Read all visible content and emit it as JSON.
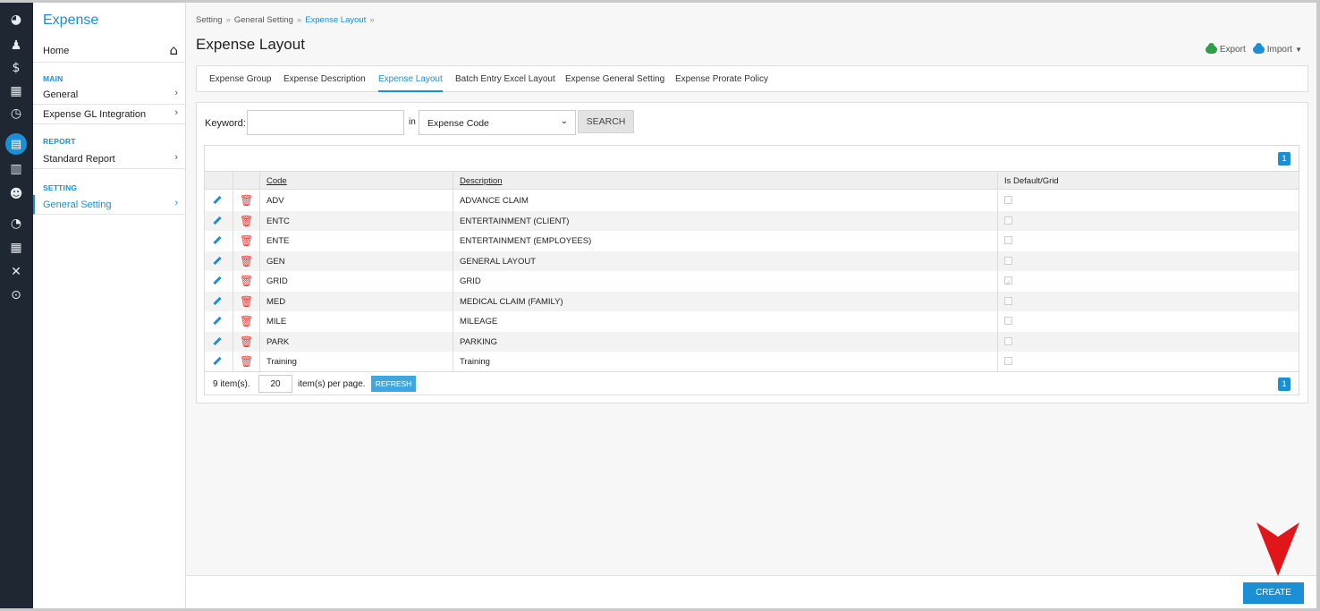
{
  "app": {
    "title": "Expense"
  },
  "rail": {
    "icons": [
      "dashboard-icon",
      "people-icon",
      "payroll-icon",
      "calendar-icon",
      "time-icon",
      "expense-icon",
      "leave-icon",
      "user-icon",
      "chart-icon",
      "table-icon",
      "tools-icon",
      "upload-icon"
    ]
  },
  "sidebar": {
    "home": "Home",
    "sections": [
      {
        "label": "MAIN",
        "items": [
          "General",
          "Expense GL Integration"
        ]
      },
      {
        "label": "REPORT",
        "items": [
          "Standard Report"
        ]
      },
      {
        "label": "SETTING",
        "items": [
          "General Setting"
        ]
      }
    ]
  },
  "breadcrumb": [
    "Setting",
    "General Setting",
    "Expense Layout"
  ],
  "page": {
    "title": "Expense Layout",
    "export_label": "Export",
    "import_label": "Import"
  },
  "tabs": [
    "Expense Group",
    "Expense Description",
    "Expense Layout",
    "Batch Entry Excel Layout",
    "Expense General Setting",
    "Expense Prorate Policy"
  ],
  "active_tab": "Expense Layout",
  "search": {
    "keyword_label": "Keyword:",
    "keyword_value": "",
    "in_label": "in",
    "field_selected": "Expense Code",
    "button": "SEARCH"
  },
  "grid": {
    "columns": [
      "Code",
      "Description",
      "Is Default/Grid"
    ],
    "rows": [
      {
        "code": "ADV",
        "description": "ADVANCE CLAIM",
        "is_default": false
      },
      {
        "code": "ENTC",
        "description": "ENTERTAINMENT (CLIENT)",
        "is_default": false
      },
      {
        "code": "ENTE",
        "description": "ENTERTAINMENT (EMPLOYEES)",
        "is_default": false
      },
      {
        "code": "GEN",
        "description": "GENERAL LAYOUT",
        "is_default": false
      },
      {
        "code": "GRID",
        "description": "GRID",
        "is_default": true
      },
      {
        "code": "MED",
        "description": "MEDICAL CLAIM (FAMILY)",
        "is_default": false
      },
      {
        "code": "MILE",
        "description": "MILEAGE",
        "is_default": false
      },
      {
        "code": "PARK",
        "description": "PARKING",
        "is_default": false
      },
      {
        "code": "Training",
        "description": "Training",
        "is_default": false
      }
    ],
    "page_number": "1",
    "item_count": "9 item(s).",
    "per_page_value": "20",
    "per_page_label": "item(s) per page.",
    "refresh_button": "REFRESH"
  },
  "create_button": "CREATE",
  "colors": {
    "accent": "#1b8fd6",
    "rail_bg": "#1f2733",
    "delete": "#e53935",
    "export": "#2e9e4a",
    "annotation": "#e0161b"
  }
}
